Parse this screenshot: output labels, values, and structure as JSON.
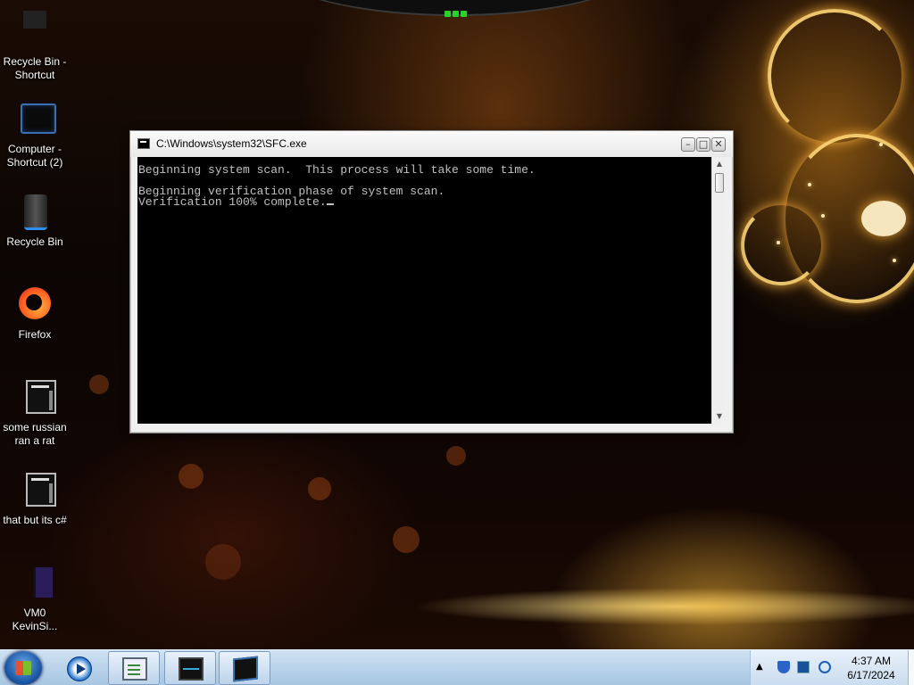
{
  "desktop": {
    "icons": [
      {
        "label": "Recycle Bin - Shortcut",
        "icon": "recycle-bin-shortcut-icon"
      },
      {
        "label": "Computer - Shortcut (2)",
        "icon": "computer-icon"
      },
      {
        "label": "Recycle Bin",
        "icon": "recycle-bin-icon"
      },
      {
        "label": "Firefox",
        "icon": "firefox-icon"
      },
      {
        "label": "some russian ran a rat",
        "icon": "file-icon"
      },
      {
        "label": "that but its c#",
        "icon": "file-icon"
      },
      {
        "label": "VM0 KevinSi...",
        "icon": "document-icon"
      }
    ]
  },
  "window": {
    "title": "C:\\Windows\\system32\\SFC.exe",
    "buttons": {
      "minimize": "–",
      "maximize": "□",
      "close": "✕"
    },
    "console_lines": [
      "Beginning system scan.  This process will take some time.",
      "",
      "Beginning verification phase of system scan.",
      "Verification 100% complete."
    ]
  },
  "taskbar": {
    "start_label": "Start",
    "items": [
      {
        "name": "media-player",
        "icon": "media-player-icon"
      },
      {
        "name": "notepad",
        "icon": "notepad-icon"
      },
      {
        "name": "task-monitor",
        "icon": "monitor-icon"
      },
      {
        "name": "computer",
        "icon": "computer-icon"
      }
    ],
    "tray": {
      "arrow": "▲",
      "time": "4:37 AM",
      "date": "6/17/2024"
    }
  },
  "colors": {
    "console_bg": "#000000",
    "console_fg": "#c0c0c0",
    "taskbar": "#b9d3ea"
  }
}
